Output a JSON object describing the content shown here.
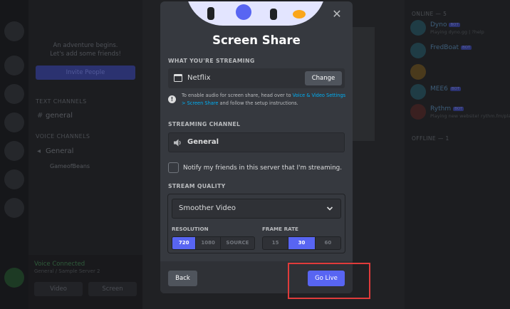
{
  "background": {
    "empty_state": [
      "An adventure begins.",
      "Let's add some friends!"
    ],
    "invite_label": "Invite People",
    "text_channels_heading": "TEXT CHANNELS",
    "text_channel": "general",
    "voice_channels_heading": "VOICE CHANNELS",
    "voice_channel": "General",
    "voice_member": "GameofBeans",
    "voice_connected": "Voice Connected",
    "voice_sub": "General / Sample Server 2",
    "video_label": "Video",
    "screen_label": "Screen",
    "members_online_heading": "ONLINE — 5",
    "members_offline_heading": "OFFLINE — 1",
    "members": [
      {
        "name": "Dyno",
        "status": "Playing dyno.gg | ?help"
      },
      {
        "name": "FredBoat",
        "status": ""
      },
      {
        "name": "",
        "status": ""
      },
      {
        "name": "MEE6",
        "status": ""
      },
      {
        "name": "Rythm",
        "status": "Playing new website! rythm.fm/play..."
      }
    ],
    "bot_tag": "BOT"
  },
  "modal": {
    "title": "Screen Share",
    "streaming_label": "WHAT YOU'RE STREAMING",
    "streaming_app": "Netflix",
    "change_label": "Change",
    "info_prefix": "To enable audio for screen share, head over to ",
    "info_link": "Voice & Video Settings > Screen Share",
    "info_suffix": " and follow the setup instructions.",
    "channel_label": "STREAMING CHANNEL",
    "channel_name": "General",
    "notify_label": "Notify my friends in this server that I'm streaming.",
    "quality_label": "STREAM QUALITY",
    "quality_selected": "Smoother Video",
    "resolution_label": "RESOLUTION",
    "resolution_options": [
      "720",
      "1080",
      "SOURCE"
    ],
    "resolution_selected": "720",
    "framerate_label": "FRAME RATE",
    "framerate_options": [
      "15",
      "30",
      "60"
    ],
    "framerate_selected": "30",
    "back_label": "Back",
    "golive_label": "Go Live",
    "close_icon": "close-icon",
    "accent_color": "#5865f2",
    "highlight_color": "#e03b3b"
  }
}
